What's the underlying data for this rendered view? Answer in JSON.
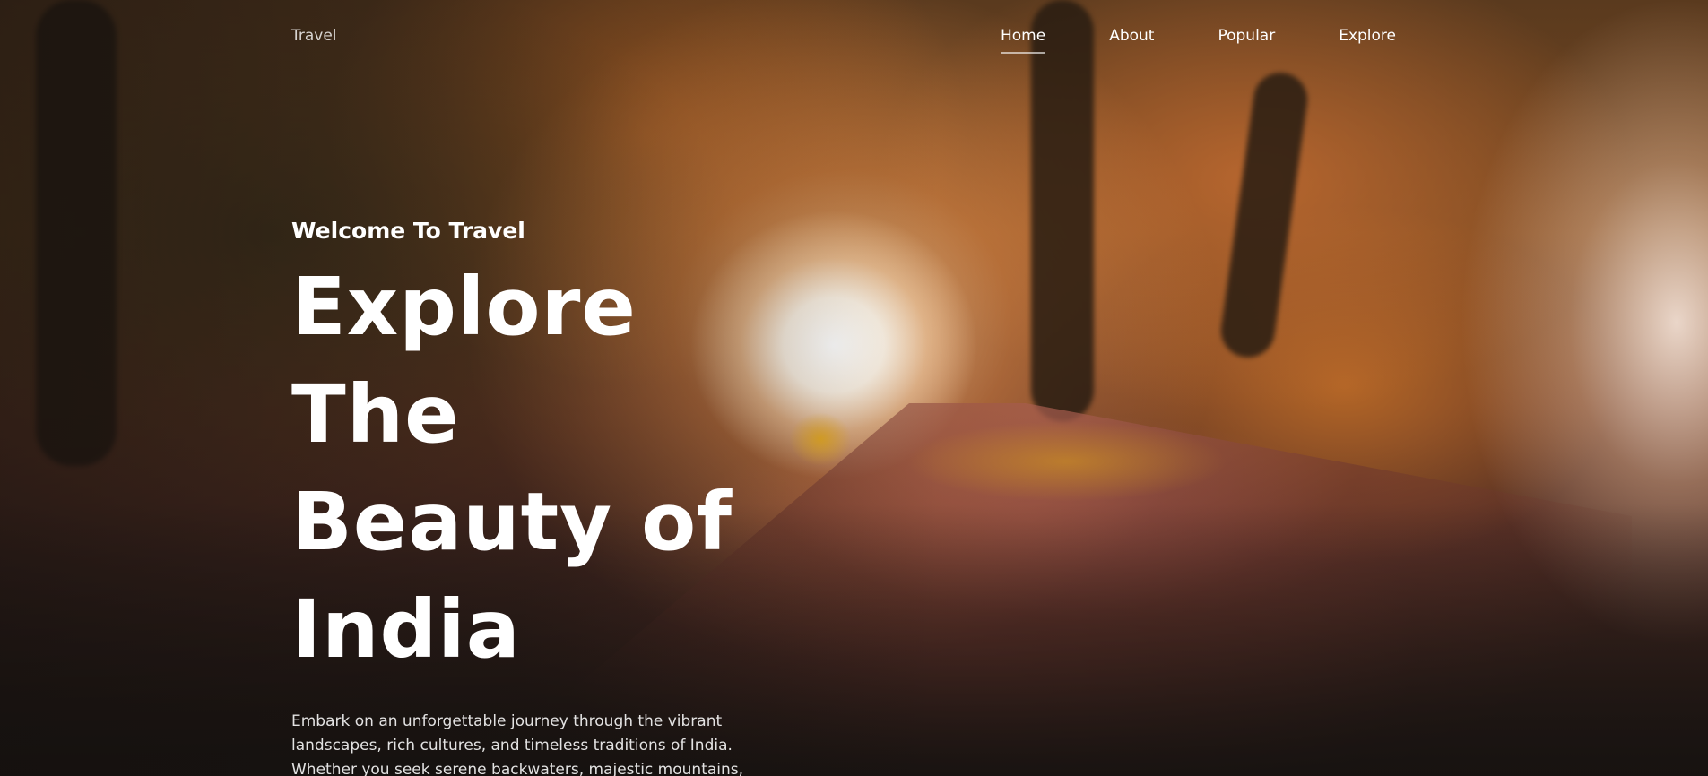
{
  "nav": {
    "brand": "Travel",
    "links": [
      {
        "label": "Home",
        "active": true
      },
      {
        "label": "About",
        "active": false
      },
      {
        "label": "Popular",
        "active": false
      },
      {
        "label": "Explore",
        "active": false
      }
    ]
  },
  "hero": {
    "welcome": "Welcome To Travel",
    "headline_lines": [
      "Explore",
      "The",
      "Beauty of",
      "India"
    ],
    "description": "Embark on an unforgettable journey through the vibrant landscapes, rich cultures, and timeless traditions of India. Whether you seek serene backwaters, majestic mountains,"
  },
  "colors": {
    "text": "#ffffff",
    "nav_underline": "#bfbfbf",
    "accent_warm": "#d9822b"
  }
}
